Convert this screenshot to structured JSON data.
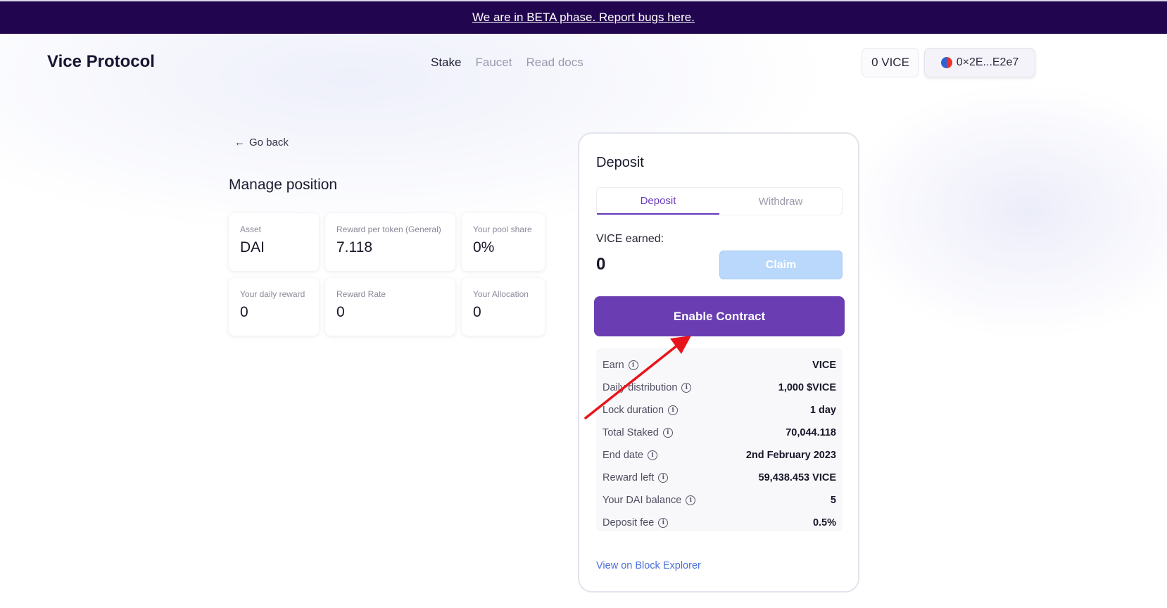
{
  "banner": {
    "text": "We are in BETA phase. Report bugs here."
  },
  "header": {
    "logo": "Vice Protocol",
    "nav": [
      "Stake",
      "Faucet",
      "Read docs"
    ],
    "active_nav": "Stake",
    "vice_balance": "0 VICE",
    "wallet_address": "0×2E...E2e7"
  },
  "page": {
    "go_back": "Go back",
    "title": "Manage position",
    "stats": [
      {
        "label": "Asset",
        "value": "DAI"
      },
      {
        "label": "Reward per token (General)",
        "value": "7.118"
      },
      {
        "label": "Your pool share",
        "value": "0%"
      },
      {
        "label": "Your daily reward",
        "value": "0"
      },
      {
        "label": "Reward Rate",
        "value": "0"
      },
      {
        "label": "Your Allocation",
        "value": "0"
      }
    ]
  },
  "deposit": {
    "title": "Deposit",
    "tabs": [
      "Deposit",
      "Withdraw"
    ],
    "active_tab": "Deposit",
    "earned_label": "VICE earned:",
    "earned_value": "0",
    "claim_label": "Claim",
    "enable_label": "Enable Contract",
    "details": [
      {
        "key": "Earn",
        "value": "VICE"
      },
      {
        "key": "Daily distribution",
        "value": "1,000 $VICE"
      },
      {
        "key": "Lock duration",
        "value": "1 day"
      },
      {
        "key": "Total Staked",
        "value": "70,044.118"
      },
      {
        "key": "End date",
        "value": "2nd February 2023"
      },
      {
        "key": "Reward left",
        "value": "59,438.453 VICE"
      },
      {
        "key": "Your DAI balance",
        "value": "5"
      },
      {
        "key": "Deposit fee",
        "value": "0.5%"
      }
    ],
    "explorer_link": "View on Block Explorer"
  },
  "colors": {
    "banner": "#22054f",
    "accent": "#6a3eb2",
    "claim_disabled": "#b9d8fb",
    "link": "#4a6fd8",
    "annotation_arrow": "#e8141b"
  }
}
